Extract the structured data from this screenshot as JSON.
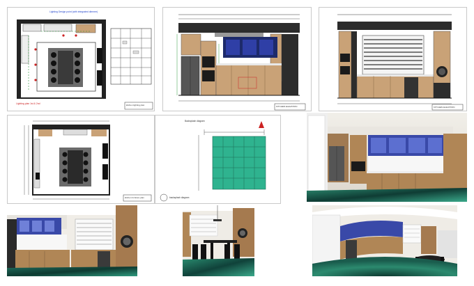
{
  "colors": {
    "paper": "#ffffff",
    "line": "#222222",
    "dim_green": "#2a9a3a",
    "red_note": "#cc2222",
    "blue_note": "#2244cc",
    "wood": "#b98b5e",
    "dark_cab": "#2c2c2c",
    "backsplash_blue": "#2f3fa6",
    "tile_teal": "#2fb38f",
    "floor_marble": "#1f6b5b"
  },
  "panels": {
    "plan_lighting": {
      "note_top": "Lighting Design point (with integrated dimmer)",
      "note_red": "Lighting plan 1st & 2nd",
      "stamp": "kitchen lighting plan"
    },
    "elevation_a": {
      "stamp": "KITCHEN ELEVATION"
    },
    "elevation_b": {
      "stamp": "KITCHEN ELEVATION"
    },
    "plan_furniture": {
      "stamp": "kitchen furniture plan"
    },
    "backsplash": {
      "note": "Backsplash diagram",
      "stamp": "backsplash diagram"
    }
  },
  "icons": {
    "north_arrow": "north-arrow-icon"
  }
}
